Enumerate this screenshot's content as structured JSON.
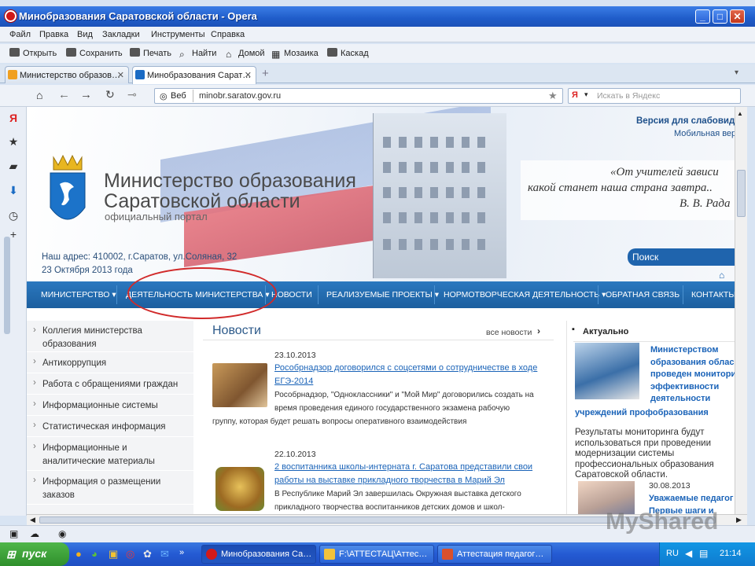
{
  "window": {
    "title": "Минобразования Саратовской области - Opera",
    "controls": {
      "min": "_",
      "max": "□",
      "close": "✕"
    }
  },
  "menu": [
    "Файл",
    "Правка",
    "Вид",
    "Закладки",
    "Инструменты",
    "Справка"
  ],
  "toolbar": [
    "Открыть",
    "Сохранить",
    "Печать",
    "Найти",
    "Домой",
    "Мозаика",
    "Каскад"
  ],
  "tabs": [
    {
      "label": "Министерство образов…",
      "close": "✕"
    },
    {
      "label": "Минобразования Сарат…",
      "close": "✕"
    }
  ],
  "address": {
    "web_label": "Веб",
    "url": "minobr.saratov.gov.ru",
    "search_placeholder": "Искать в Яндекс",
    "search_engine": "Я"
  },
  "site": {
    "ministry_line1": "Министерство образования",
    "ministry_line2": "Саратовской области",
    "portal": "официальный портал",
    "address_line": "Наш адрес: 410002, г.Саратов, ул.Соляная, 32",
    "date_line": "23 Октября 2013 года",
    "low_vision": "Версия для слабовид",
    "mobile": "Мобильная вер",
    "quote_line1": "«От учителей зависи",
    "quote_line2": "какой станет наша страна завтра..",
    "quote_author": "В. В. Рада",
    "search_label": "Поиск"
  },
  "nav": [
    "МИНИСТЕРСТВО ▾",
    "ДЕЯТЕЛЬНОСТЬ МИНИСТЕРСТВА ▾",
    "НОВОСТИ",
    "РЕАЛИЗУЕМЫЕ ПРОЕКТЫ ▾",
    "НОРМОТВОРЧЕСКАЯ ДЕЯТЕЛЬНОСТЬ ▾",
    "ОБРАТНАЯ СВЯЗЬ",
    "КОНТАКТЫ"
  ],
  "sidebar": [
    {
      "line1": "Коллегия министерства",
      "line2": "образования"
    },
    {
      "line1": "Антикоррупция",
      "line2": ""
    },
    {
      "line1": "Работа с обращениями граждан",
      "line2": ""
    },
    {
      "line1": "Информационные системы",
      "line2": ""
    },
    {
      "line1": "Статистическая информация",
      "line2": ""
    },
    {
      "line1": "Информационные и",
      "line2": "аналитические материалы"
    },
    {
      "line1": "Информация о размещении",
      "line2": "заказов"
    }
  ],
  "news": {
    "heading": "Новости",
    "all_link": "все новости",
    "items": [
      {
        "date": "23.10.2013",
        "title1": "Рособрнадзор договорился с соцсетями о сотрудничестве в ходе",
        "title2": "ЕГЭ-2014",
        "body1": "Рособрнадзор, \"Одноклассники\" и \"Мой Мир\" договорились создать на",
        "body2": "время проведения единого государственного экзамена рабочую",
        "body3": "группу, которая будет решать вопросы оперативного взаимодействия"
      },
      {
        "date": "22.10.2013",
        "title1": "2 воспитанника школы-интерната г. Саратова представили свои",
        "title2": "работы на выставке прикладного творчества в Марий Эл",
        "body1": "В Республике Марий Эл завершилась Окружная выставка детского",
        "body2": "прикладного творчества воспитанников детских домов и школ-",
        "body3": ""
      }
    ]
  },
  "actual": {
    "heading": "Актуально",
    "headline": [
      "Министерством",
      "образования облас",
      "проведен монитори",
      "эффективности",
      "деятельности"
    ],
    "headline_full": "учреждений профобразования",
    "body": [
      "Результаты мониторинга будут",
      "использоваться при проведении",
      "модернизации системы",
      "профессиональных образования",
      "Саратовской области."
    ],
    "date2": "30.08.2013",
    "title2a": "Уважаемые педагог",
    "title2b": "Первые шаги и"
  },
  "taskbar": {
    "start": "пуск",
    "tasks": [
      "Минобразования Са…",
      "F:\\АТТЕСТАЦ\\Аттес…",
      "Аттестация педагог…"
    ],
    "lang": "RU",
    "time": "21:14"
  },
  "watermark": "MyShared"
}
